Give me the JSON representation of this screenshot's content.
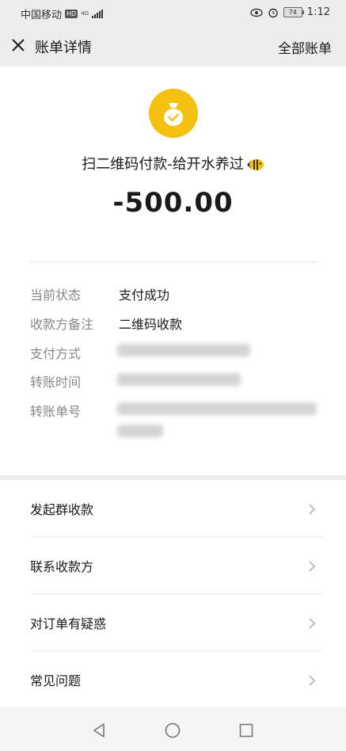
{
  "status": {
    "carrier": "中国移动",
    "hd_badge": "HD",
    "network": "4G",
    "battery": "74",
    "time": "1:12"
  },
  "nav": {
    "title": "账单详情",
    "all_bills": "全部账单"
  },
  "transaction": {
    "merchant": "扫二维码付款-给开水养过",
    "amount": "-500.00"
  },
  "details": {
    "status_label": "当前状态",
    "status_value": "支付成功",
    "payee_note_label": "收款方备注",
    "payee_note_value": "二维码收款",
    "payment_method_label": "支付方式",
    "transfer_time_label": "转账时间",
    "transfer_no_label": "转账单号"
  },
  "menu": [
    {
      "label": "发起群收款"
    },
    {
      "label": "联系收款方"
    },
    {
      "label": "对订单有疑惑"
    },
    {
      "label": "常见问题"
    }
  ],
  "colors": {
    "accent": "#f5c110",
    "background": "#ededed"
  }
}
